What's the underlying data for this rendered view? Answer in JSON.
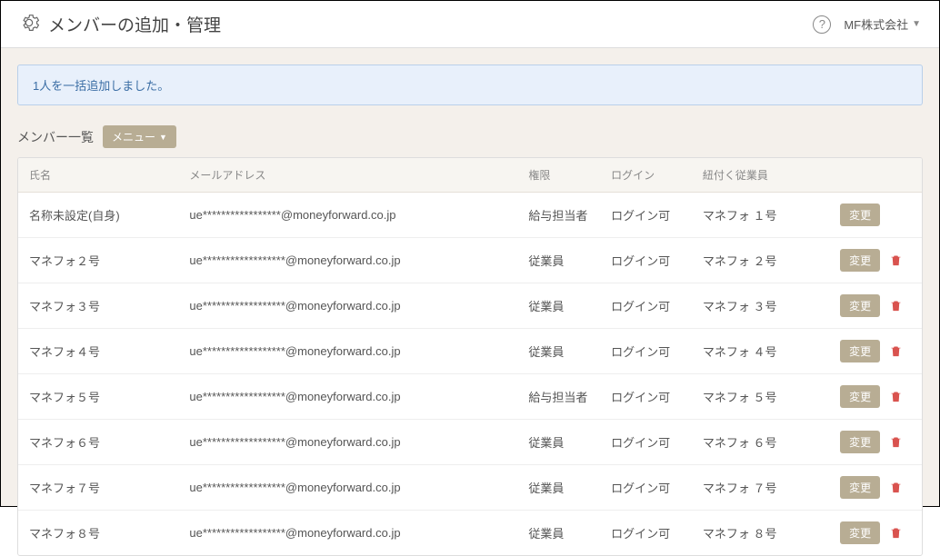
{
  "header": {
    "title": "メンバーの追加・管理",
    "org_label": "MF株式会社"
  },
  "alert": {
    "message": "1人を一括追加しました。"
  },
  "section": {
    "title": "メンバー一覧",
    "menu_label": "メニュー"
  },
  "table": {
    "headers": {
      "name": "氏名",
      "email": "メールアドレス",
      "role": "権限",
      "login": "ログイン",
      "employee": "紐付く従業員",
      "actions": ""
    },
    "edit_label": "変更",
    "rows": [
      {
        "name": "名称未設定(自身)",
        "email": "ue*****************@moneyforward.co.jp",
        "role": "給与担当者",
        "login": "ログイン可",
        "employee": "マネフォ １号",
        "deletable": false
      },
      {
        "name": "マネフォ２号",
        "email": "ue******************@moneyforward.co.jp",
        "role": "従業員",
        "login": "ログイン可",
        "employee": "マネフォ ２号",
        "deletable": true
      },
      {
        "name": "マネフォ３号",
        "email": "ue******************@moneyforward.co.jp",
        "role": "従業員",
        "login": "ログイン可",
        "employee": "マネフォ ３号",
        "deletable": true
      },
      {
        "name": "マネフォ４号",
        "email": "ue******************@moneyforward.co.jp",
        "role": "従業員",
        "login": "ログイン可",
        "employee": "マネフォ ４号",
        "deletable": true
      },
      {
        "name": "マネフォ５号",
        "email": "ue******************@moneyforward.co.jp",
        "role": "給与担当者",
        "login": "ログイン可",
        "employee": "マネフォ ５号",
        "deletable": true
      },
      {
        "name": "マネフォ６号",
        "email": "ue******************@moneyforward.co.jp",
        "role": "従業員",
        "login": "ログイン可",
        "employee": "マネフォ ６号",
        "deletable": true
      },
      {
        "name": "マネフォ７号",
        "email": "ue******************@moneyforward.co.jp",
        "role": "従業員",
        "login": "ログイン可",
        "employee": "マネフォ ７号",
        "deletable": true
      },
      {
        "name": "マネフォ８号",
        "email": "ue******************@moneyforward.co.jp",
        "role": "従業員",
        "login": "ログイン可",
        "employee": "マネフォ ８号",
        "deletable": true
      }
    ]
  }
}
